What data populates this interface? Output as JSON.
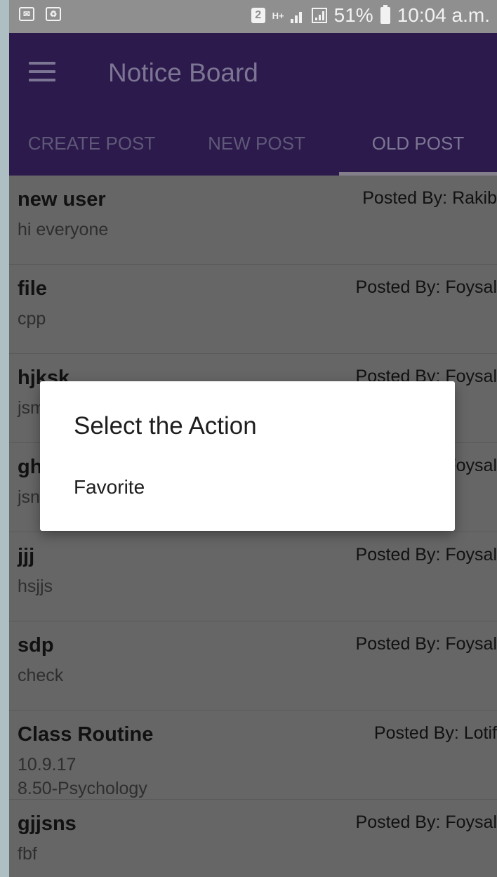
{
  "status_bar": {
    "sim_badge": "2",
    "network_type": "H+",
    "battery_percent": "51%",
    "time": "10:04 a.m.",
    "icons": [
      "mail-icon",
      "recycle-icon",
      "sim-icon",
      "signal-icon",
      "battery-icon"
    ]
  },
  "app_bar": {
    "title": "Notice Board",
    "tabs": [
      {
        "label": "CREATE POST",
        "active": false
      },
      {
        "label": "NEW POST",
        "active": false
      },
      {
        "label": "OLD POST",
        "active": true
      }
    ]
  },
  "posts": [
    {
      "title": "new user",
      "body": "hi everyone",
      "posted_by": "Posted By: Rakib"
    },
    {
      "title": "file",
      "body": "cpp",
      "posted_by": "Posted By: Foysal"
    },
    {
      "title": "hjksk",
      "body": "jsm",
      "posted_by": "Posted By: Foysal"
    },
    {
      "title": "ghj",
      "body": "jsnn",
      "posted_by": "Posted By: Foysal"
    },
    {
      "title": "jjj",
      "body": "hsjjs",
      "posted_by": "Posted By: Foysal"
    },
    {
      "title": "sdp",
      "body": "check",
      "posted_by": "Posted By: Foysal"
    },
    {
      "title": "Class Routine",
      "body": "10.9.17\n8.50-Psychology",
      "posted_by": "Posted By: Lotif"
    },
    {
      "title": "gjjsns",
      "body": "fbf",
      "posted_by": "Posted By: Foysal"
    }
  ],
  "dialog": {
    "title": "Select the Action",
    "items": [
      "Favorite"
    ]
  },
  "colors": {
    "app_bar": "#2b1a4b",
    "dim_overlay_rows": "#666666",
    "status_bar": "#8f8f8f"
  }
}
